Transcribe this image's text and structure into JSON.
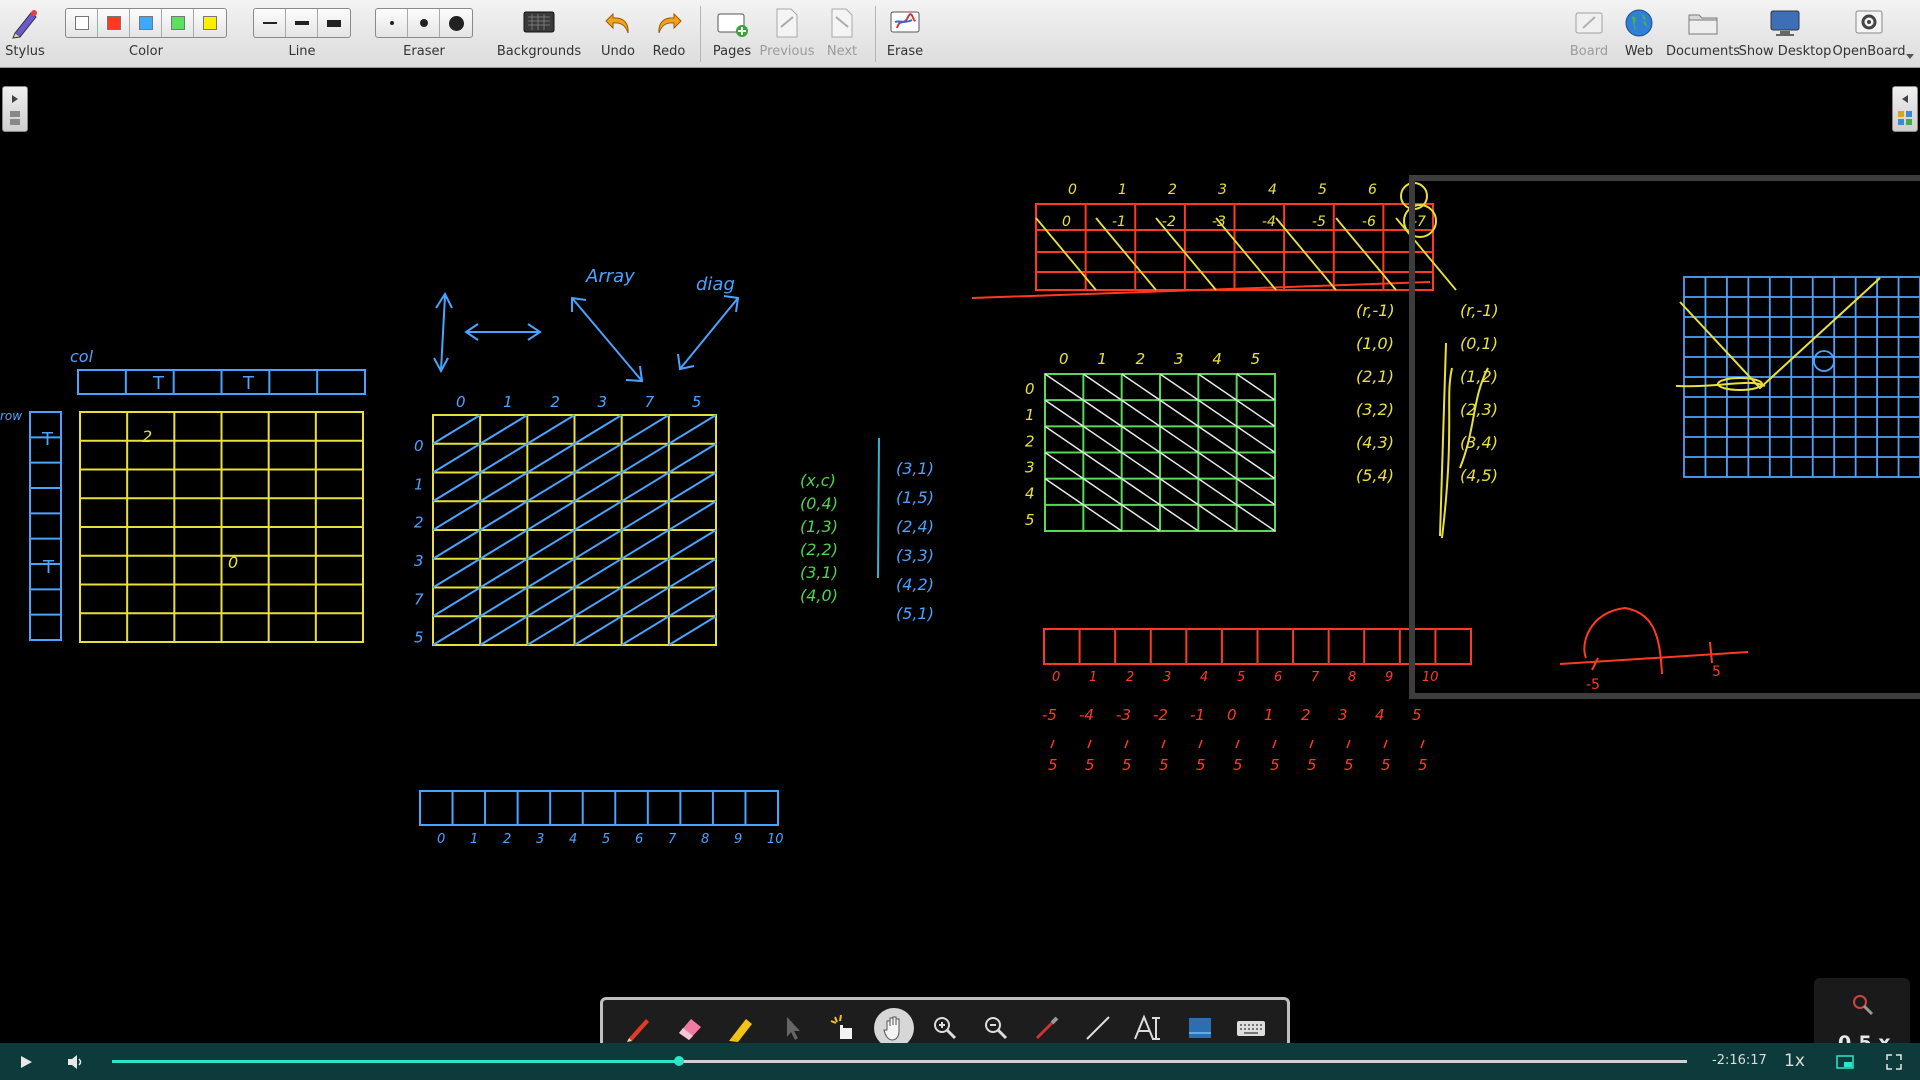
{
  "toolbar": {
    "stylus": "Stylus",
    "color": "Color",
    "line": "Line",
    "eraser": "Eraser",
    "backgrounds": "Backgrounds",
    "undo": "Undo",
    "redo": "Redo",
    "pages": "Pages",
    "previous": "Previous",
    "next": "Next",
    "erase": "Erase",
    "board": "Board",
    "web": "Web",
    "documents": "Documents",
    "show_desktop": "Show Desktop",
    "openboard": "OpenBoard",
    "color_swatches": [
      "#ffffff",
      "#ff3b1f",
      "#3fa9ff",
      "#5ee05e",
      "#ffee00"
    ]
  },
  "dock": {
    "tools": [
      "pen-icon",
      "eraser-icon",
      "marker-icon",
      "selector-icon",
      "interact-icon",
      "hand-icon",
      "zoom-in-icon",
      "zoom-out-icon",
      "laser-pointer-icon",
      "line-icon",
      "text-icon",
      "capture-icon",
      "keyboard-icon"
    ],
    "active": "hand-icon"
  },
  "zoom_badge": "0.5 x",
  "player": {
    "time_remaining": "-2:16:17",
    "speed": "1x",
    "progress": 0.36
  },
  "board": {
    "col_label": "col",
    "row_label": "row",
    "table1_t1": "T",
    "table1_t2": "T",
    "side_t1": "T",
    "side_t2": "T",
    "array_label": "Array",
    "diag_label": "diag",
    "grid1_cols": [
      "0",
      "1",
      "2",
      "3",
      "7",
      "5"
    ],
    "grid1_rows": [
      "0",
      "1",
      "2",
      "3",
      "7",
      "5"
    ],
    "pairs1_left": [
      "(x,c)",
      "(0,4)",
      "(1,3)",
      "(2,2)",
      "(3,1)",
      "(4,0)"
    ],
    "pairs1_right": [
      "(3,1)",
      "(1,5)",
      "(2,4)",
      "(3,3)",
      "(4,2)",
      "(5,1)"
    ],
    "strip1_idx": [
      "0",
      "1",
      "2",
      "3",
      "4",
      "5",
      "6",
      "7",
      "8",
      "9",
      "10"
    ],
    "grid2_cols": [
      "0",
      "1",
      "2",
      "3",
      "4",
      "5"
    ],
    "grid2_rows": [
      "0",
      "1",
      "2",
      "3",
      "4",
      "5"
    ],
    "pairs2_left": [
      "(r,-1)",
      "(1,0)",
      "(2,1)",
      "(3,2)",
      "(4,3)",
      "(5,4)"
    ],
    "pairs2_right": [
      "(r,-1)",
      "(0,1)",
      "(1,2)",
      "(2,3)",
      "(3,4)",
      "(4,5)"
    ],
    "strip2_idx": [
      "0",
      "1",
      "2",
      "3",
      "4",
      "5",
      "6",
      "7",
      "8",
      "9",
      "10"
    ],
    "strip2_row1": [
      "-5",
      "-4",
      "-3",
      "-2",
      "-1",
      "0",
      "1",
      "2",
      "3",
      "4",
      "5"
    ],
    "strip2_row3": [
      "5",
      "5",
      "5",
      "5",
      "5",
      "5",
      "5",
      "5",
      "5",
      "5",
      "5"
    ],
    "top_idx": [
      "0",
      "1",
      "2",
      "3",
      "4",
      "5",
      "6"
    ],
    "top_cells": [
      "0",
      "-1",
      "-2",
      "-3",
      "-4",
      "-5",
      "-6",
      "-7"
    ],
    "graph_labels": [
      "-5",
      "5"
    ]
  }
}
